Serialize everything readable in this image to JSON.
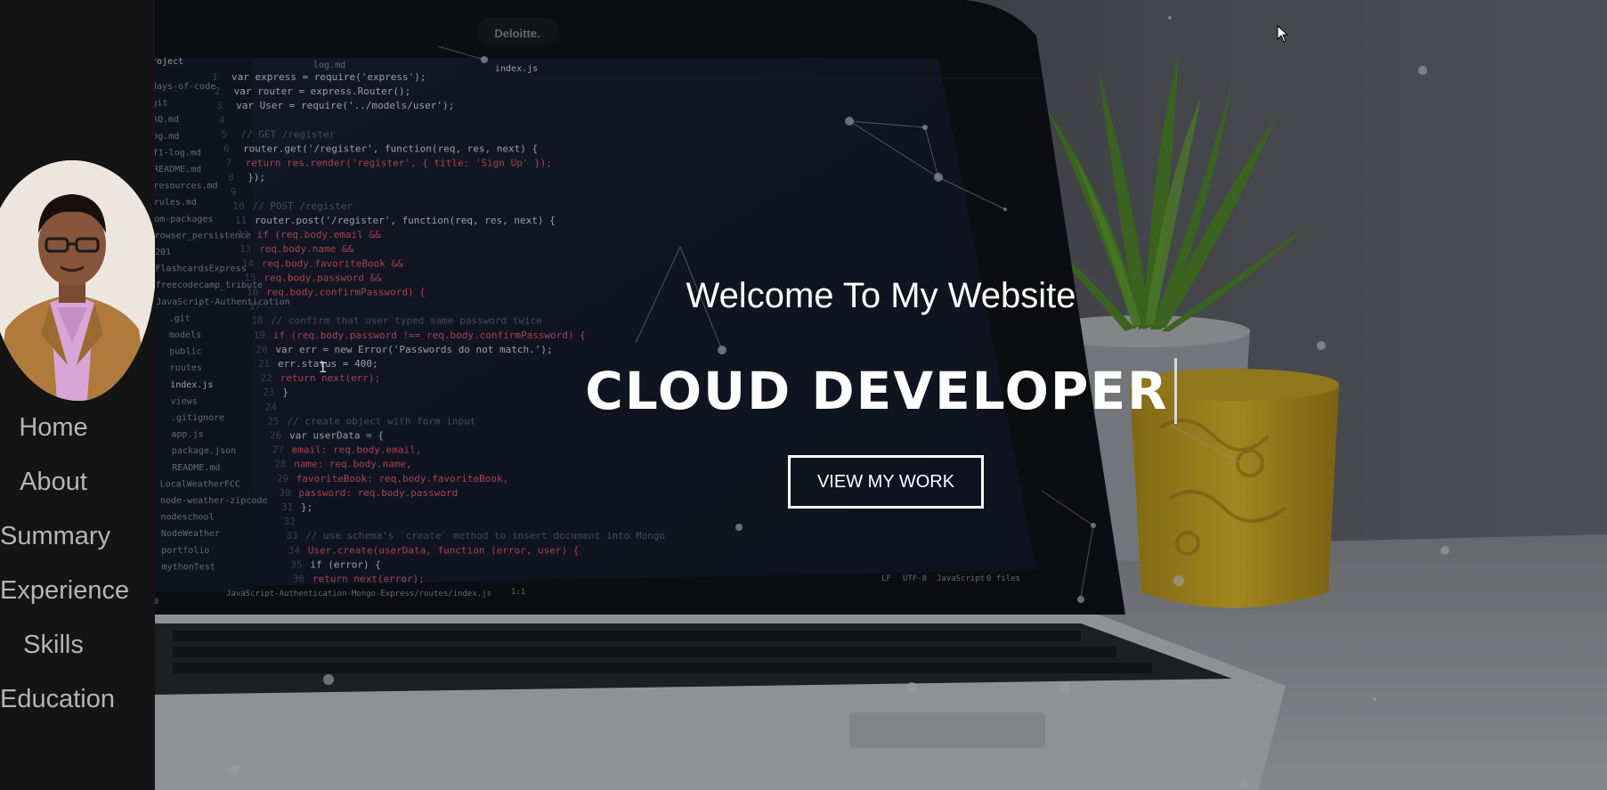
{
  "sidebar": {
    "avatar_alt": "profile-photo",
    "nav_items": [
      "Home",
      "About",
      "Summary",
      "Experience",
      "Skills",
      "Education"
    ]
  },
  "hero": {
    "welcome": "Welcome To My Website",
    "headline": "CLOUD DEVELOPER",
    "cta_label": "VIEW MY WORK",
    "laptop_brand": "Deloitte.",
    "editor": {
      "tabs": [
        "log.md",
        "index.js"
      ],
      "sidebar_header": "roject",
      "files": [
        "days-of-code",
        "git",
        "AQ.md",
        "og.md",
        "f1-log.md",
        "README.md",
        "resources.md",
        "rules.md",
        "om-packages",
        "rowser_persistence",
        "201",
        "FlashcardsExpress",
        "freecodecamp_tribute",
        "JavaScript-Authentication",
        ".git",
        "models",
        "public",
        "routes",
        "index.js",
        "views",
        ".gitignore",
        "app.js",
        "package.json",
        "README.md",
        "LocalWeatherFCC",
        "node-weather-zipcode",
        "nodeschool",
        "NodeWeather",
        "portfolio",
        "mythonTest"
      ],
      "code": [
        "var express = require('express');",
        "var router = express.Router();",
        "var User = require('../models/user');",
        "",
        "// GET /register",
        "router.get('/register', function(req, res, next) {",
        "  return res.render('register', { title: 'Sign Up' });",
        "});",
        "",
        "// POST /register",
        "router.post('/register', function(req, res, next) {",
        "  if (req.body.email &&",
        "    req.body.name &&",
        "    req.body.favoriteBook &&",
        "    req.body.password &&",
        "    req.body.confirmPassword) {",
        "",
        "    // confirm that user typed same password twice",
        "    if (req.body.password !== req.body.confirmPassword) {",
        "      var err = new Error('Passwords do not match.');",
        "      err.status = 400;",
        "      return next(err);",
        "    }",
        "",
        "    // create object with form input",
        "    var userData = {",
        "      email: req.body.email,",
        "      name: req.body.name,",
        "      favoriteBook: req.body.favoriteBook,",
        "      password: req.body.password",
        "    };",
        "",
        "    // use schema's `create` method to insert document into Mongo",
        "    User.create(userData, function (error, user) {",
        "      if (error) {",
        "        return next(error);"
      ],
      "status_left": "JavaScript-Authentication-Mongo-Express/routes/index.js",
      "status_pos": "1:1",
      "status_counts": "0 0",
      "status_right": [
        "LF",
        "UTF-8",
        "JavaScript",
        "0 files"
      ]
    }
  },
  "colors": {
    "sidebar_bg": "#141414",
    "nav_text": "#b5b5b5",
    "hero_text": "#ffffff",
    "editor_bg": "#1a2031",
    "plant_green": "#4f8a2a",
    "pot_yellow": "#d8b227"
  }
}
